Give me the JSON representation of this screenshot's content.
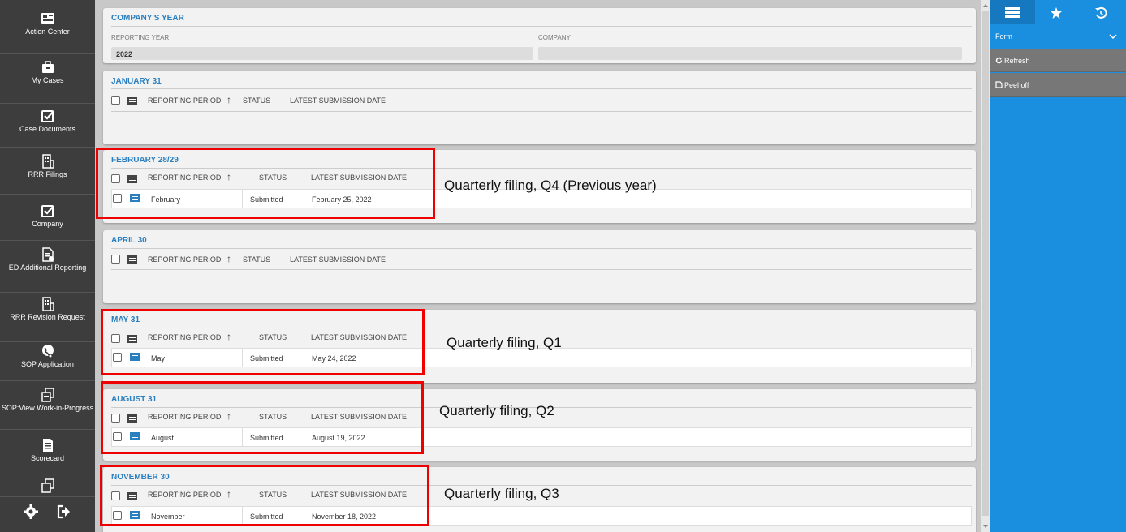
{
  "nav": {
    "items": [
      {
        "label": "Action Center",
        "icon": "action-center-icon"
      },
      {
        "label": "My Cases",
        "icon": "briefcase-icon"
      },
      {
        "label": "Case Documents",
        "icon": "checkbox-icon"
      },
      {
        "label": "RRR Filings",
        "icon": "building-icon"
      },
      {
        "label": "Company",
        "icon": "checkbox-icon"
      },
      {
        "label": "ED Additional Reporting",
        "icon": "document-icon"
      },
      {
        "label": "RRR Revision Request",
        "icon": "building-icon"
      },
      {
        "label": "SOP Application",
        "icon": "globe-icon"
      },
      {
        "label": "SOP:View Work-in-Progress",
        "icon": "documents-icon"
      },
      {
        "label": "Scorecard",
        "icon": "scorecard-icon"
      }
    ]
  },
  "company_year": {
    "title": "COMPANY'S YEAR",
    "reporting_year_label": "REPORTING YEAR",
    "reporting_year_value": "2022",
    "company_label": "COMPANY",
    "company_value": ""
  },
  "table_header": {
    "period": "REPORTING PERIOD",
    "sort": "↑",
    "status": "STATUS",
    "date": "LATEST SUBMISSION DATE"
  },
  "sections": [
    {
      "title": "JANUARY 31"
    },
    {
      "title": "FEBRUARY 28/29",
      "row": {
        "period": "February",
        "status": "Submitted",
        "date": "February 25, 2022"
      },
      "annotation": "Quarterly filing, Q4 (Previous year)"
    },
    {
      "title": "APRIL 30"
    },
    {
      "title": "MAY 31",
      "row": {
        "period": "May",
        "status": "Submitted",
        "date": "May 24, 2022"
      },
      "annotation": "Quarterly filing, Q1"
    },
    {
      "title": "AUGUST 31",
      "row": {
        "period": "August",
        "status": "Submitted",
        "date": "August 19, 2022"
      },
      "annotation": "Quarterly filing, Q2"
    },
    {
      "title": "NOVEMBER 30",
      "row": {
        "period": "November",
        "status": "Submitted",
        "date": "November 18, 2022"
      },
      "annotation": "Quarterly filing, Q3"
    }
  ],
  "right_panel": {
    "form_label": "Form",
    "refresh": "Refresh",
    "peel_off": "Peel off"
  },
  "colors": {
    "accent": "#1a8fe0",
    "title": "#2a7fc0",
    "highlight": "#e00000"
  }
}
